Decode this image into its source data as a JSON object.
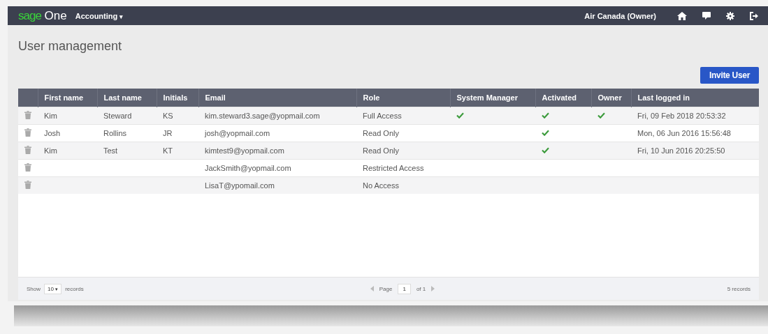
{
  "navbar": {
    "logo_brand": "sage",
    "logo_product": "One",
    "module": "Accounting",
    "module_caret": "▾",
    "account": "Air Canada (Owner)"
  },
  "page": {
    "title": "User management",
    "invite_button": "Invite User"
  },
  "table": {
    "columns": [
      "First name",
      "Last name",
      "Initials",
      "Email",
      "Role",
      "System Manager",
      "Activated",
      "Owner",
      "Last logged in"
    ],
    "rows": [
      {
        "first_name": "Kim",
        "last_name": "Steward",
        "initials": "KS",
        "email": "kim.steward3.sage@yopmail.com",
        "role": "Full Access",
        "system_manager": true,
        "activated": true,
        "owner": true,
        "last_logged_in": "Fri, 09 Feb 2018 20:53:32"
      },
      {
        "first_name": "Josh",
        "last_name": "Rollins",
        "initials": "JR",
        "email": "josh@yopmail.com",
        "role": "Read Only",
        "system_manager": false,
        "activated": true,
        "owner": false,
        "last_logged_in": "Mon, 06 Jun 2016 15:56:48"
      },
      {
        "first_name": "Kim",
        "last_name": "Test",
        "initials": "KT",
        "email": "kimtest9@yopmail.com",
        "role": "Read Only",
        "system_manager": false,
        "activated": true,
        "owner": false,
        "last_logged_in": "Fri, 10 Jun 2016 20:25:50"
      },
      {
        "email": "JackSmith@yopmail.com",
        "role": "Restricted Access",
        "system_manager": false,
        "activated": false,
        "owner": false
      },
      {
        "email": "LisaT@ypomail.com",
        "role": "No Access",
        "system_manager": false,
        "activated": false,
        "owner": false
      }
    ]
  },
  "footer": {
    "show_label": "Show",
    "page_size": "10",
    "page_size_caret": "▾",
    "records_label": "records",
    "page_label": "Page",
    "page_value": "1",
    "page_of": "of 1",
    "total": "5 records"
  }
}
